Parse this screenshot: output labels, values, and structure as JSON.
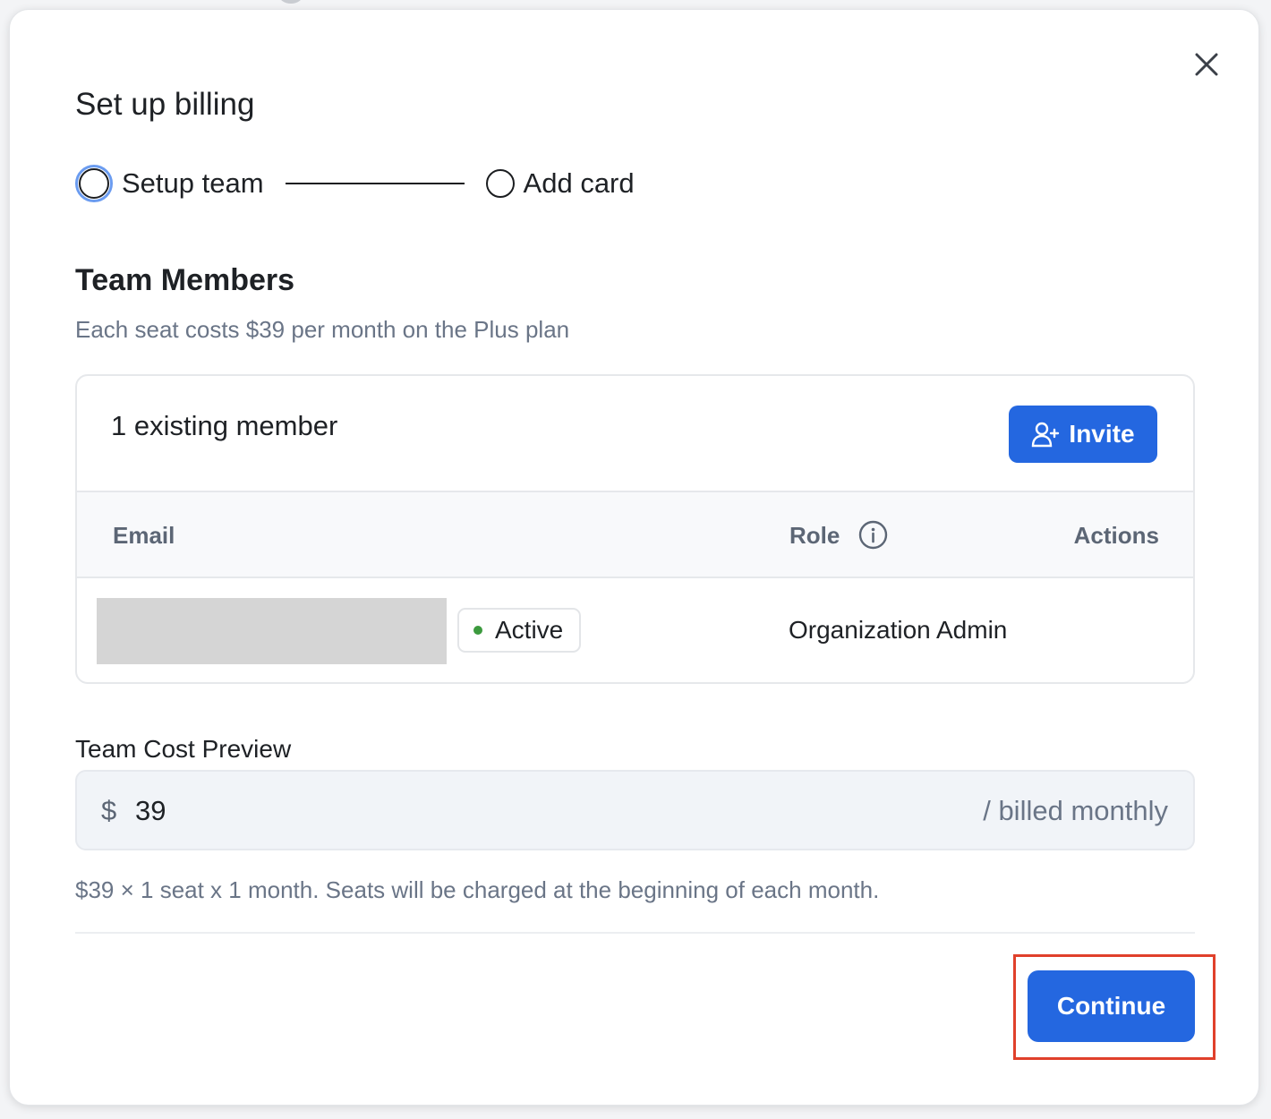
{
  "dialog": {
    "title": "Set up billing",
    "close_icon": "close-icon"
  },
  "stepper": {
    "steps": [
      {
        "label": "Setup team",
        "state": "current"
      },
      {
        "label": "Add card",
        "state": "upcoming"
      }
    ]
  },
  "team_members": {
    "title": "Team Members",
    "subtitle": "Each seat costs $39 per month on the Plus plan",
    "existing_count_label": "1 existing member",
    "invite_label": "Invite",
    "invite_icon": "user-plus-icon",
    "columns": {
      "email": "Email",
      "role": "Role",
      "actions": "Actions"
    },
    "rows": [
      {
        "email": "",
        "status": "Active",
        "role": "Organization Admin"
      }
    ]
  },
  "cost_preview": {
    "label": "Team Cost Preview",
    "currency": "$",
    "amount": "39",
    "period": "/ billed monthly",
    "note": "$39 × 1 seat x 1 month. Seats will be charged at the beginning of each month."
  },
  "footer": {
    "continue_label": "Continue"
  },
  "colors": {
    "primary": "#2467e0",
    "status_active": "#3c9a3e",
    "highlight": "#e0402b",
    "muted_text": "#6a7587"
  }
}
